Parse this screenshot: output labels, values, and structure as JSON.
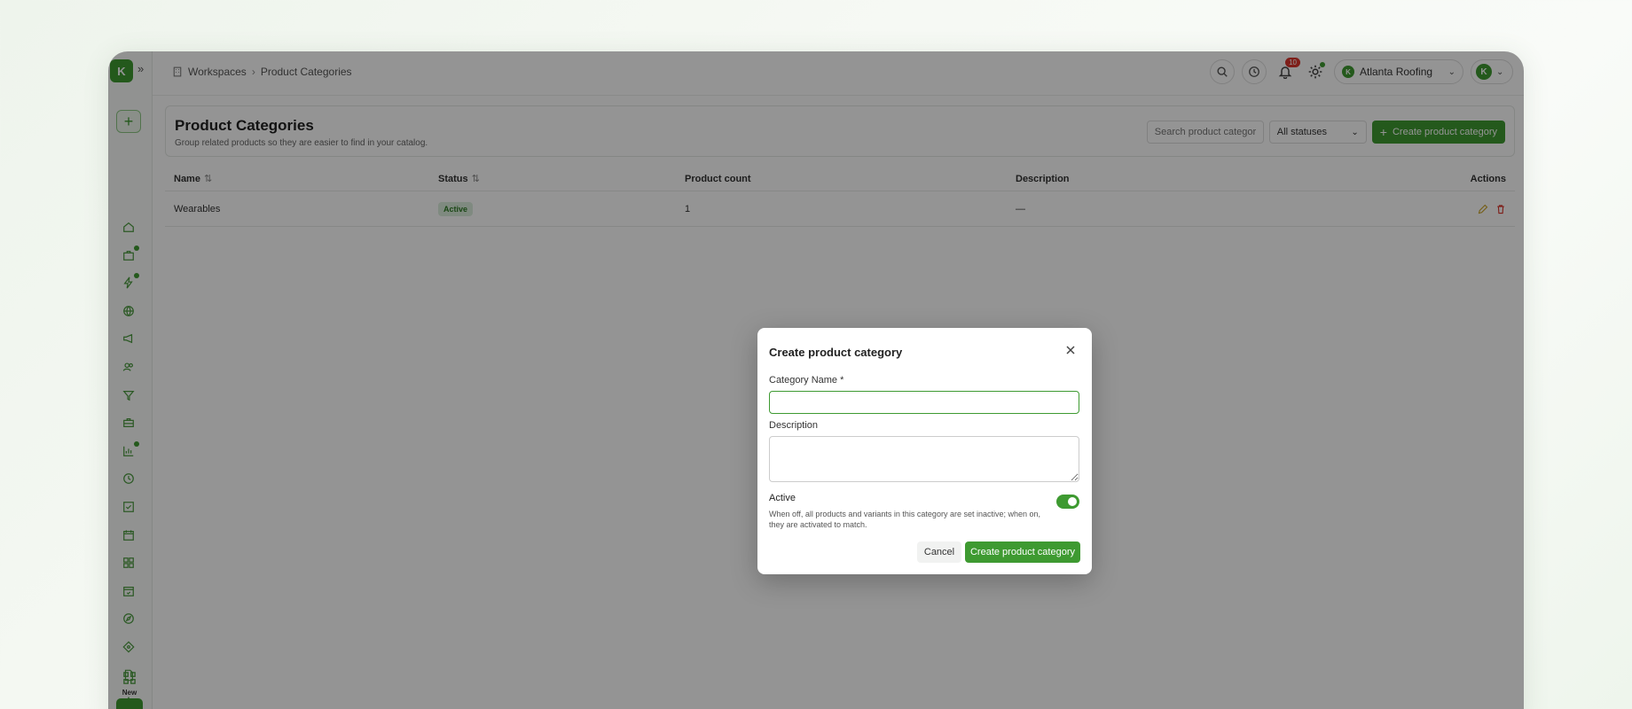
{
  "breadcrumb": {
    "items": [
      "Workspaces",
      "Product Categories"
    ]
  },
  "topbar": {
    "notifications_count": "10",
    "workspace": "Atlanta Roofing",
    "logo_letter": "K"
  },
  "sidebar": {
    "new_label": "New",
    "icons": [
      "home-icon",
      "briefcase-icon",
      "bolt-icon",
      "globe-icon",
      "megaphone-icon",
      "users-icon",
      "filter-icon",
      "toolbox-icon",
      "bar-chart-icon",
      "clock-icon",
      "check-square-icon",
      "calendar-icon",
      "grid-icon",
      "calendar-check-icon",
      "compass-icon",
      "diamond-icon",
      "file-icon",
      "star-icon"
    ]
  },
  "page": {
    "title": "Product Categories",
    "subtitle": "Group related products so they are easier to find in your catalog.",
    "search_placeholder": "Search product categorie",
    "status_filter": "All statuses",
    "create_button": "Create product category"
  },
  "table": {
    "columns": [
      "Name",
      "Status",
      "Product count",
      "Description",
      "Actions"
    ],
    "rows": [
      {
        "name": "Wearables",
        "status": "Active",
        "product_count": "1",
        "description": "—"
      }
    ]
  },
  "modal": {
    "title": "Create product category",
    "category_name_label": "Category Name *",
    "category_name_value": "",
    "description_label": "Description",
    "description_value": "",
    "active_label": "Active",
    "active": true,
    "active_help": "When off, all products and variants in this category are set inactive; when on, they are activated to match.",
    "cancel_button": "Cancel",
    "submit_button": "Create product category"
  },
  "colors": {
    "accent": "#3e9a31",
    "danger": "#d9342b",
    "edit": "#c9a227"
  }
}
